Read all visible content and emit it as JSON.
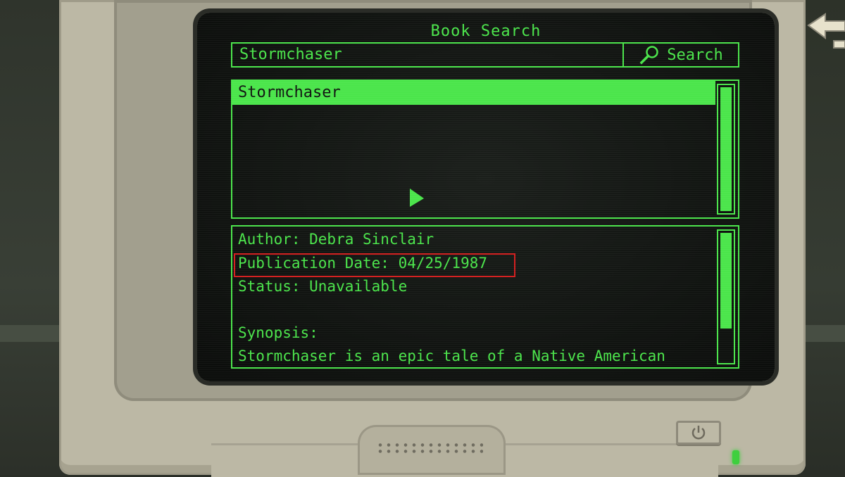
{
  "screen": {
    "title": "Book Search",
    "search": {
      "value": "Stormchaser",
      "button_label": "Search",
      "button_icon": "magnifier-icon"
    },
    "results": [
      "Stormchaser"
    ],
    "details": {
      "author": "Author: Debra Sinclair",
      "publication_date": "Publication Date: 04/25/1987",
      "status": "Status: Unavailable",
      "synopsis_label": "Synopsis:",
      "synopsis_text": "Stormchaser is an epic tale of a Native American"
    }
  },
  "colors": {
    "terminal_green": "#4be54b",
    "highlight_red": "#d41e1e",
    "casing": "#bcb8a5"
  },
  "icons": [
    "back-arrow-icon",
    "power-icon",
    "pointer-cursor-icon",
    "magnifier-icon"
  ]
}
